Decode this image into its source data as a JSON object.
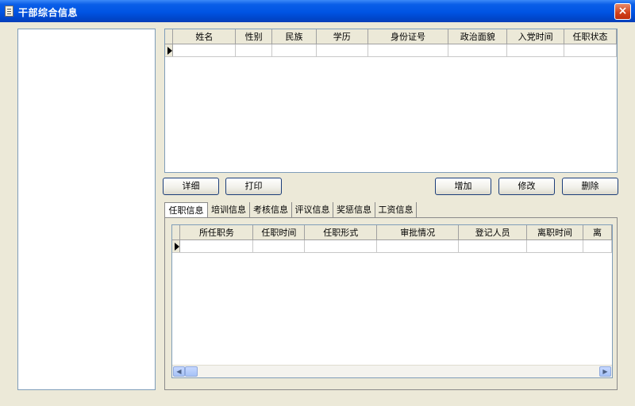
{
  "window": {
    "title": "干部综合信息",
    "close_label": "×"
  },
  "grid_top": {
    "columns": [
      "姓名",
      "性别",
      "民族",
      "学历",
      "身份证号",
      "政治面貌",
      "入党时间",
      "任职状态"
    ]
  },
  "buttons": {
    "detail": "详细",
    "print": "打印",
    "add": "增加",
    "modify": "修改",
    "delete": "删除"
  },
  "tabs": [
    "任职信息",
    "培训信息",
    "考核信息",
    "评议信息",
    "奖惩信息",
    "工资信息"
  ],
  "grid_bottom": {
    "columns": [
      "所任职务",
      "任职时间",
      "任职形式",
      "审批情况",
      "登记人员",
      "离职时间",
      "离"
    ]
  },
  "scrollbar": {
    "left_arrow": "◀",
    "right_arrow": "▶"
  }
}
